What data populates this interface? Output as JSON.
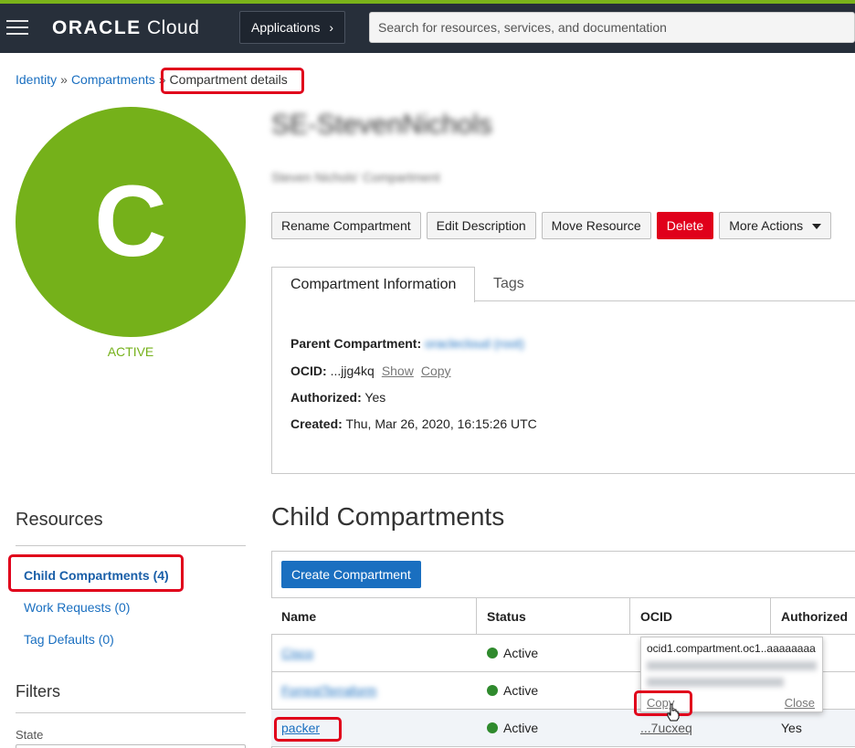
{
  "header": {
    "brand_bold": "ORACLE",
    "brand_light": "Cloud",
    "apps_label": "Applications",
    "search_placeholder": "Search for resources, services, and documentation"
  },
  "breadcrumb": {
    "items": [
      "Identity",
      "Compartments"
    ],
    "separator": "»",
    "current": "Compartment details"
  },
  "compartment": {
    "avatar_letter": "C",
    "status": "ACTIVE",
    "name": "SE-StevenNichols",
    "description": "Steven Nichols' Compartment"
  },
  "actions": {
    "rename": "Rename Compartment",
    "edit": "Edit Description",
    "move": "Move Resource",
    "delete": "Delete",
    "more": "More Actions"
  },
  "tabs": {
    "info": "Compartment Information",
    "tags": "Tags"
  },
  "info": {
    "parent_label": "Parent Compartment:",
    "parent_value": "oraclecloud (root)",
    "ocid_label": "OCID:",
    "ocid_value": "...jjg4kq",
    "show": "Show",
    "copy": "Copy",
    "authorized_label": "Authorized:",
    "authorized_value": "Yes",
    "created_label": "Created:",
    "created_value": "Thu, Mar 26, 2020, 16:15:26 UTC"
  },
  "resources": {
    "title": "Resources",
    "items": [
      "Child Compartments (4)",
      "Work Requests (0)",
      "Tag Defaults (0)"
    ]
  },
  "filters": {
    "title": "Filters",
    "state_label": "State"
  },
  "child": {
    "title": "Child Compartments",
    "create_label": "Create Compartment",
    "columns": [
      "Name",
      "Status",
      "OCID",
      "Authorized"
    ],
    "rows": [
      {
        "name": "Cisco",
        "status": "Active",
        "ocid": "",
        "authorized": ""
      },
      {
        "name": "ForrestTerraform",
        "status": "Active",
        "ocid": "",
        "authorized": ""
      },
      {
        "name": "packer",
        "status": "Active",
        "ocid": "...7ucxeq",
        "authorized": "Yes"
      }
    ]
  },
  "popover": {
    "ocid_text": "ocid1.compartment.oc1..aaaaaaaa",
    "copy": "Copy",
    "close": "Close"
  },
  "colors": {
    "header_bg": "#272f3a",
    "accent_green": "#75b11a",
    "link_blue": "#1a6fc0",
    "delete_red": "#e0001b",
    "highlight_red": "#e0001b"
  }
}
